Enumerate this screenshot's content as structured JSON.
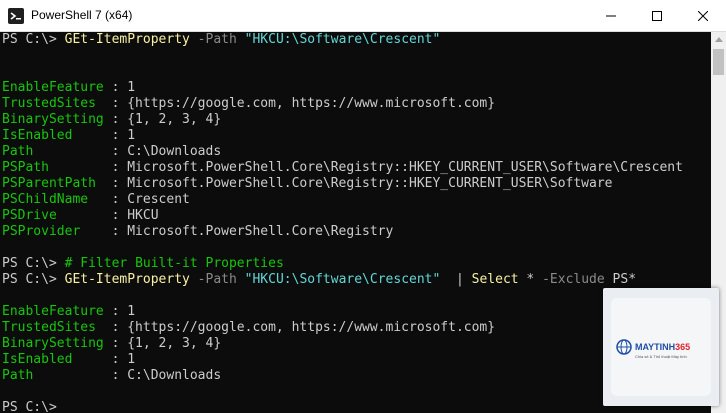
{
  "window": {
    "title": "PowerShell 7 (x64)"
  },
  "controls": {
    "minimize": "minimize",
    "maximize": "maximize",
    "close": "close"
  },
  "terminal": {
    "lines": [
      [
        [
          "PS C:\\> ",
          "white"
        ],
        [
          "GEt-ItemProperty",
          "yellow"
        ],
        [
          " -Path ",
          "gray"
        ],
        [
          "\"HKCU:\\Software\\Crescent\"",
          "cyan"
        ]
      ],
      [],
      [
        [
          "EnableFeature",
          "green"
        ],
        [
          " : 1",
          "white"
        ]
      ],
      [
        [
          "TrustedSites ",
          "green"
        ],
        [
          " : {https://google.com, https://www.microsoft.com}",
          "white"
        ]
      ],
      [
        [
          "BinarySetting",
          "green"
        ],
        [
          " : {1, 2, 3, 4}",
          "white"
        ]
      ],
      [
        [
          "IsEnabled    ",
          "green"
        ],
        [
          " : 1",
          "white"
        ]
      ],
      [
        [
          "Path         ",
          "green"
        ],
        [
          " : C:\\Downloads",
          "white"
        ]
      ],
      [
        [
          "PSPath       ",
          "green"
        ],
        [
          " : Microsoft.PowerShell.Core\\Registry::HKEY_CURRENT_USER\\Software\\Crescent",
          "white"
        ]
      ],
      [
        [
          "PSParentPath ",
          "green"
        ],
        [
          " : Microsoft.PowerShell.Core\\Registry::HKEY_CURRENT_USER\\Software",
          "white"
        ]
      ],
      [
        [
          "PSChildName  ",
          "green"
        ],
        [
          " : Crescent",
          "white"
        ]
      ],
      [
        [
          "PSDrive      ",
          "green"
        ],
        [
          " : HKCU",
          "white"
        ]
      ],
      [
        [
          "PSProvider   ",
          "green"
        ],
        [
          " : Microsoft.PowerShell.Core\\Registry",
          "white"
        ]
      ],
      [],
      [
        [
          "PS C:\\> ",
          "white"
        ],
        [
          "# Filter Built-it Properties",
          "green"
        ]
      ],
      [
        [
          "PS C:\\> ",
          "white"
        ],
        [
          "GEt-ItemProperty",
          "yellow"
        ],
        [
          " -Path ",
          "gray"
        ],
        [
          "\"HKCU:\\Software\\Crescent\"",
          "cyan"
        ],
        [
          "  | ",
          "white"
        ],
        [
          "Select",
          "yellow"
        ],
        [
          " * ",
          "white"
        ],
        [
          "-Exclude",
          "gray"
        ],
        [
          " PS*",
          "white"
        ]
      ],
      [],
      [
        [
          "EnableFeature",
          "green"
        ],
        [
          " : 1",
          "white"
        ]
      ],
      [
        [
          "TrustedSites ",
          "green"
        ],
        [
          " : {https://google.com, https://www.microsoft.com}",
          "white"
        ]
      ],
      [
        [
          "BinarySetting",
          "green"
        ],
        [
          " : {1, 2, 3, 4}",
          "white"
        ]
      ],
      [
        [
          "IsEnabled    ",
          "green"
        ],
        [
          " : 1",
          "white"
        ]
      ],
      [
        [
          "Path         ",
          "green"
        ],
        [
          " : C:\\Downloads",
          "white"
        ]
      ],
      [],
      [
        [
          "PS C:\\>",
          "white"
        ]
      ]
    ]
  },
  "watermark": {
    "brand_a": "MAYTINH",
    "brand_b": "365",
    "tagline": "Chia sẻ & Thủ thuật Máy tính"
  },
  "colors": {
    "green": "#16c60c",
    "yellow": "#f9f1a5",
    "cyan": "#61d6d6",
    "gray": "#8a8a8a",
    "white": "#cccccc"
  }
}
